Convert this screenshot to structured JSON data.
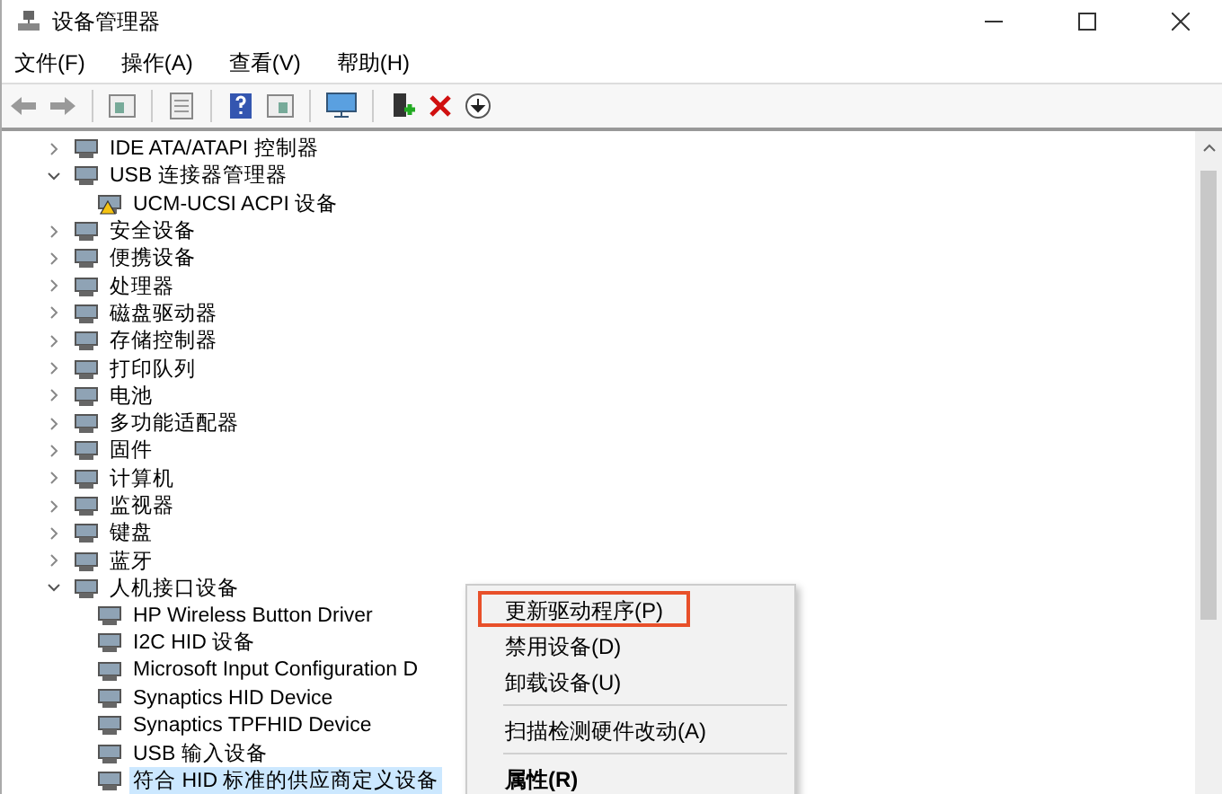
{
  "window": {
    "title": "设备管理器"
  },
  "menu": [
    {
      "label": "文件(F)"
    },
    {
      "label": "操作(A)"
    },
    {
      "label": "查看(V)"
    },
    {
      "label": "帮助(H)"
    }
  ],
  "tree": [
    {
      "label": "IDE ATA/ATAPI 控制器",
      "expanded": false,
      "selected": false
    },
    {
      "label": "USB 连接器管理器",
      "expanded": true,
      "selected": false,
      "children": [
        {
          "label": "UCM-UCSI ACPI 设备",
          "warning": true,
          "selected": false
        }
      ]
    },
    {
      "label": "安全设备",
      "expanded": false,
      "selected": false
    },
    {
      "label": "便携设备",
      "expanded": false,
      "selected": false
    },
    {
      "label": "处理器",
      "expanded": false,
      "selected": false
    },
    {
      "label": "磁盘驱动器",
      "expanded": false,
      "selected": false
    },
    {
      "label": "存储控制器",
      "expanded": false,
      "selected": false
    },
    {
      "label": "打印队列",
      "expanded": false,
      "selected": false
    },
    {
      "label": "电池",
      "expanded": false,
      "selected": false
    },
    {
      "label": "多功能适配器",
      "expanded": false,
      "selected": false
    },
    {
      "label": "固件",
      "expanded": false,
      "selected": false
    },
    {
      "label": "计算机",
      "expanded": false,
      "selected": false
    },
    {
      "label": "监视器",
      "expanded": false,
      "selected": false
    },
    {
      "label": "键盘",
      "expanded": false,
      "selected": false
    },
    {
      "label": "蓝牙",
      "expanded": false,
      "selected": false
    },
    {
      "label": "人机接口设备",
      "expanded": true,
      "selected": false,
      "children": [
        {
          "label": "HP Wireless Button Driver",
          "warning": false,
          "selected": false
        },
        {
          "label": "I2C HID 设备",
          "warning": false,
          "selected": false
        },
        {
          "label": "Microsoft Input Configuration D",
          "warning": false,
          "selected": false
        },
        {
          "label": "Synaptics HID Device",
          "warning": false,
          "selected": false
        },
        {
          "label": "Synaptics TPFHID Device",
          "warning": false,
          "selected": false
        },
        {
          "label": "USB 输入设备",
          "warning": false,
          "selected": false
        },
        {
          "label": "符合 HID 标准的供应商定义设备",
          "warning": false,
          "selected": true
        }
      ]
    }
  ],
  "context_menu": [
    {
      "kind": "item",
      "label": "更新驱动程序(P)",
      "selected": true,
      "default": false
    },
    {
      "kind": "item",
      "label": "禁用设备(D)",
      "selected": false,
      "default": false
    },
    {
      "kind": "item",
      "label": "卸载设备(U)",
      "selected": false,
      "default": false
    },
    {
      "kind": "separator"
    },
    {
      "kind": "item",
      "label": "扫描检测硬件改动(A)",
      "selected": false,
      "default": false
    },
    {
      "kind": "separator"
    },
    {
      "kind": "item",
      "label": "属性(R)",
      "selected": false,
      "default": true
    }
  ]
}
